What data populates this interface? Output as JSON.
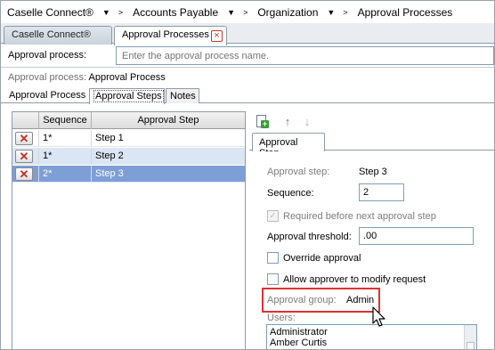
{
  "breadcrumb": [
    "Caselle Connect®",
    "Accounts Payable",
    "Organization",
    "Approval Processes"
  ],
  "doc_tabs": [
    {
      "label": "Caselle Connect®",
      "active": false
    },
    {
      "label": "Approval Processes",
      "active": true,
      "close_icon": "close-icon"
    }
  ],
  "approval_process_field": {
    "label": "Approval process:",
    "placeholder": "Enter the approval process name."
  },
  "approval_process_info": {
    "label": "Approval process:",
    "value": "Approval Process"
  },
  "sub_tabs": [
    {
      "label": "Approval Process",
      "active": false
    },
    {
      "label": "Approval Steps",
      "active": true
    },
    {
      "label": "Notes",
      "active": false
    }
  ],
  "grid": {
    "columns": [
      "Sequence",
      "Approval Step"
    ],
    "rows": [
      {
        "sequence": "1*",
        "step": "Step 1",
        "state": "normal"
      },
      {
        "sequence": "1*",
        "step": "Step 2",
        "state": "selected-light"
      },
      {
        "sequence": "2*",
        "step": "Step 3",
        "state": "selected-dark"
      }
    ],
    "delete_icon": "delete-x-icon"
  },
  "toolbar": {
    "icons": [
      "new-document-icon",
      "move-up-arrow-icon",
      "move-down-arrow-icon"
    ]
  },
  "detail_tab": {
    "label": "Approval Step"
  },
  "detail": {
    "approval_step_label": "Approval step:",
    "approval_step_value": "Step 3",
    "sequence_label": "Sequence:",
    "sequence_value": "2",
    "required_label": "Required before next approval step",
    "threshold_label": "Approval threshold:",
    "threshold_value": ".00",
    "override_label": "Override approval",
    "modify_label": "Allow approver to modify request",
    "group_label": "Approval group:",
    "group_value": "Admin",
    "users_label": "Users:",
    "users": [
      "Administrator",
      "Amber Curtis"
    ]
  },
  "colors": {
    "highlight_border": "#e03131",
    "selected_row_dark": "#7e9ed6",
    "selected_row_light": "#dbe6f4"
  }
}
